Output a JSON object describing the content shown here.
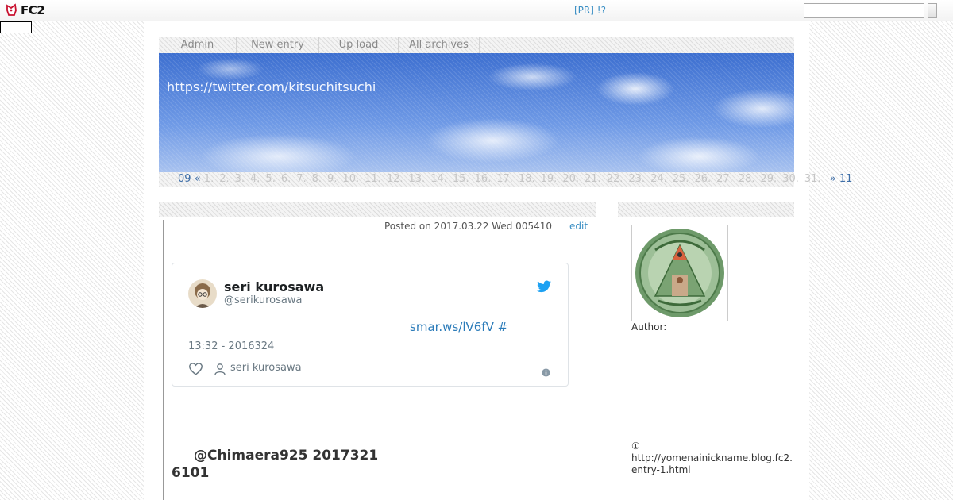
{
  "topbar": {
    "logo_text": "FC2",
    "pr_text": "[PR] !?",
    "search_value": ""
  },
  "nav": {
    "items": [
      {
        "label": "Admin"
      },
      {
        "label": "New entry"
      },
      {
        "label": "Up load"
      },
      {
        "label": "All archives"
      }
    ]
  },
  "banner": {
    "title": "https://twitter.com/kitsuchitsuchi"
  },
  "calendar": {
    "month": "09",
    "prev": "«",
    "next": "»",
    "next_month": "11",
    "days": [
      "1.",
      "2.",
      "3.",
      "4.",
      "5.",
      "6.",
      "7.",
      "8.",
      "9.",
      "10.",
      "11.",
      "12.",
      "13.",
      "14.",
      "15.",
      "16.",
      "17.",
      "18.",
      "19.",
      "20.",
      "21.",
      "22.",
      "23.",
      "24.",
      "25.",
      "26.",
      "27.",
      "28.",
      "29.",
      "30.",
      "31."
    ]
  },
  "post": {
    "meta": "Posted on 2017.03.22 Wed 005410",
    "edit_label": "edit",
    "mention": "@Chimaera925 2017321 6101"
  },
  "tweet": {
    "name": "seri kurosawa",
    "handle": "@serikurosawa",
    "link": "smar.ws/lV6fV #",
    "time": "13:32 - 2016324",
    "author": "seri kurosawa"
  },
  "sidebar": {
    "author_label": "Author:",
    "note_marker": "①",
    "note_url": "http://yomenainickname.blog.fc2.entry-1.html"
  },
  "colors": {
    "link": "#3b8fc4",
    "twitter_blue": "#1da1f2",
    "calendar_inactive": "#c6c6c6"
  }
}
